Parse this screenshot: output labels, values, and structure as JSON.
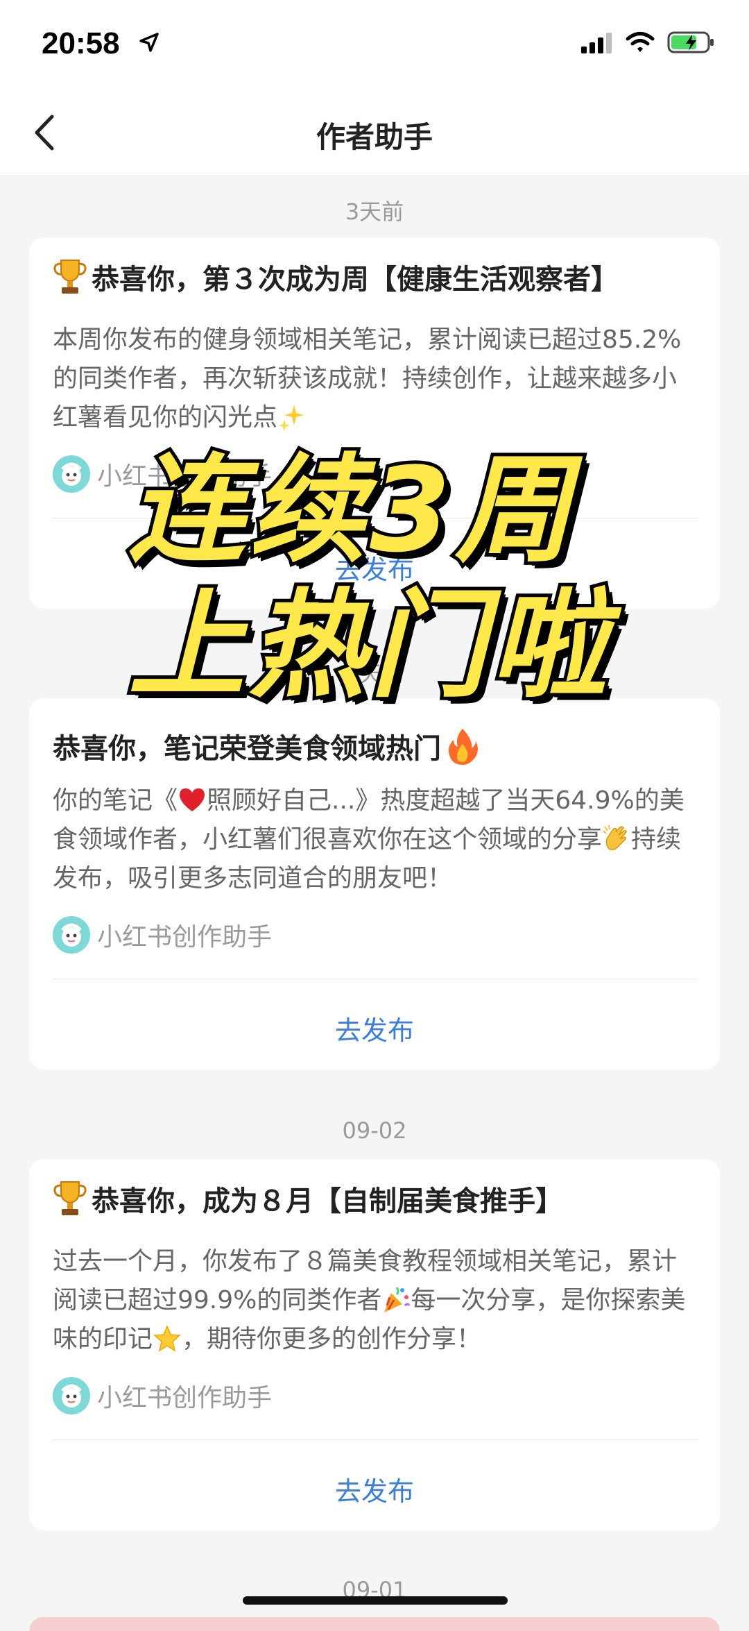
{
  "status": {
    "time": "20:58"
  },
  "nav": {
    "title": "作者助手"
  },
  "overlay": {
    "line1": "连续3周",
    "line2": "上热门啦"
  },
  "feed": [
    {
      "timestamp": "3天前",
      "title": "恭喜你，第３次成为周【健康生活观察者】",
      "body": "本周你发布的健身领域相关笔记，累计阅读已超过85.2%的同类作者，再次斩获该成就！持续创作，让越来越多小红薯看见你的闪光点",
      "author": "小红书创作助手",
      "action": "去发布"
    },
    {
      "timestamp": "3天前",
      "title": "恭喜你，笔记荣登美食领域热门",
      "body_prefix": "你的笔记《",
      "body_mid": "照顾好自己...》热度超越了当天64.9%的美食领域作者，小红薯们很喜欢你在这个领域的分享",
      "body_suffix": "持续发布，吸引更多志同道合的朋友吧！",
      "author": "小红书创作助手",
      "action": "去发布"
    },
    {
      "timestamp": "09-02",
      "title": "恭喜你，成为８月【自制届美食推手】",
      "body_prefix": "过去一个月，你发布了８篇美食教程领域相关笔记，累计阅读已超过99.9%的同类作者",
      "body_mid": "每一次分享，是你探索美味的印记",
      "body_suffix": "，期待你更多的创作分享！",
      "author": "小红书创作助手",
      "action": "去发布"
    }
  ],
  "next_timestamp": "09-01",
  "colors": {
    "link": "#3d7ed6",
    "overlay_fill": "#ffe84a",
    "background": "#f5f5f5"
  }
}
